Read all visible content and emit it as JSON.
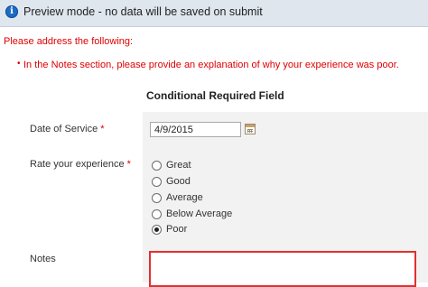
{
  "banner": {
    "text": "Preview mode - no data will be saved on submit",
    "icon": "info-icon"
  },
  "errors": {
    "heading": "Please address the following:",
    "items": [
      "In the Notes section, please provide an explanation of why your experience was poor."
    ]
  },
  "section": {
    "title": "Conditional Required Field"
  },
  "fields": {
    "date_of_service": {
      "label": "Date of Service",
      "required_marker": "*",
      "value": "4/9/2015"
    },
    "experience": {
      "label": "Rate your experience",
      "required_marker": "*",
      "options": [
        "Great",
        "Good",
        "Average",
        "Below Average",
        "Poor"
      ],
      "selected": "Poor"
    },
    "notes": {
      "label": "Notes",
      "value": ""
    }
  },
  "colors": {
    "error": "#e00000",
    "banner_bg": "#dfe6ee",
    "info_icon": "#1e6bc2"
  }
}
